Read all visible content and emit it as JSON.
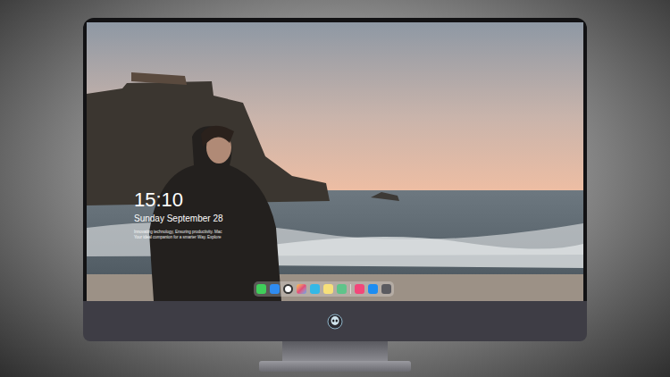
{
  "lock_screen": {
    "time": "15:10",
    "date": "Sunday September 28",
    "tagline": [
      "Innovating technology, Ensuring productivity. Mac",
      "Your ideal companion for a smarter Way. Explore"
    ]
  }
}
